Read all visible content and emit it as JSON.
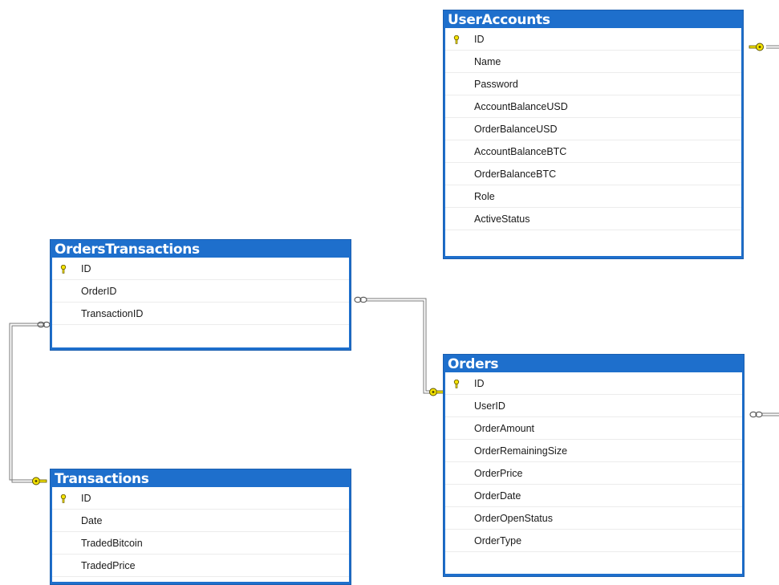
{
  "tables": {
    "useraccounts": {
      "title": "UserAccounts",
      "columns": [
        {
          "name": "ID",
          "pk": true
        },
        {
          "name": "Name",
          "pk": false
        },
        {
          "name": "Password",
          "pk": false
        },
        {
          "name": "AccountBalanceUSD",
          "pk": false
        },
        {
          "name": "OrderBalanceUSD",
          "pk": false
        },
        {
          "name": "AccountBalanceBTC",
          "pk": false
        },
        {
          "name": "OrderBalanceBTC",
          "pk": false
        },
        {
          "name": "Role",
          "pk": false
        },
        {
          "name": "ActiveStatus",
          "pk": false
        }
      ]
    },
    "orderstransactions": {
      "title": "OrdersTransactions",
      "columns": [
        {
          "name": "ID",
          "pk": true
        },
        {
          "name": "OrderID",
          "pk": false
        },
        {
          "name": "TransactionID",
          "pk": false
        }
      ]
    },
    "orders": {
      "title": "Orders",
      "columns": [
        {
          "name": "ID",
          "pk": true
        },
        {
          "name": "UserID",
          "pk": false
        },
        {
          "name": "OrderAmount",
          "pk": false
        },
        {
          "name": "OrderRemainingSize",
          "pk": false
        },
        {
          "name": "OrderPrice",
          "pk": false
        },
        {
          "name": "OrderDate",
          "pk": false
        },
        {
          "name": "OrderOpenStatus",
          "pk": false
        },
        {
          "name": "OrderType",
          "pk": false
        }
      ]
    },
    "transactions": {
      "title": "Transactions",
      "columns": [
        {
          "name": "ID",
          "pk": true
        },
        {
          "name": "Date",
          "pk": false
        },
        {
          "name": "TradedBitcoin",
          "pk": false
        },
        {
          "name": "TradedPrice",
          "pk": false
        }
      ]
    }
  },
  "relationships": [
    {
      "name": "orderstransactions-orders",
      "from": "orderstransactions",
      "to": "orders",
      "from_end": "many",
      "to_end": "key"
    },
    {
      "name": "orderstransactions-transactions",
      "from": "orderstransactions",
      "to": "transactions",
      "from_end": "many",
      "to_end": "key"
    },
    {
      "name": "useraccounts-offscreen",
      "from": "useraccounts",
      "to": "offscreen",
      "from_end": "key",
      "to_end": "none"
    },
    {
      "name": "orders-offscreen",
      "from": "orders",
      "to": "offscreen",
      "from_end": "many",
      "to_end": "none"
    }
  ],
  "colors": {
    "header": "#1e6fcc",
    "key": "#f5e400",
    "connector": "#7a7a7a"
  },
  "icons": {
    "primary_key": "key-icon",
    "relationship_key_end": "key-connector-icon",
    "relationship_many_end": "infinity-icon"
  }
}
